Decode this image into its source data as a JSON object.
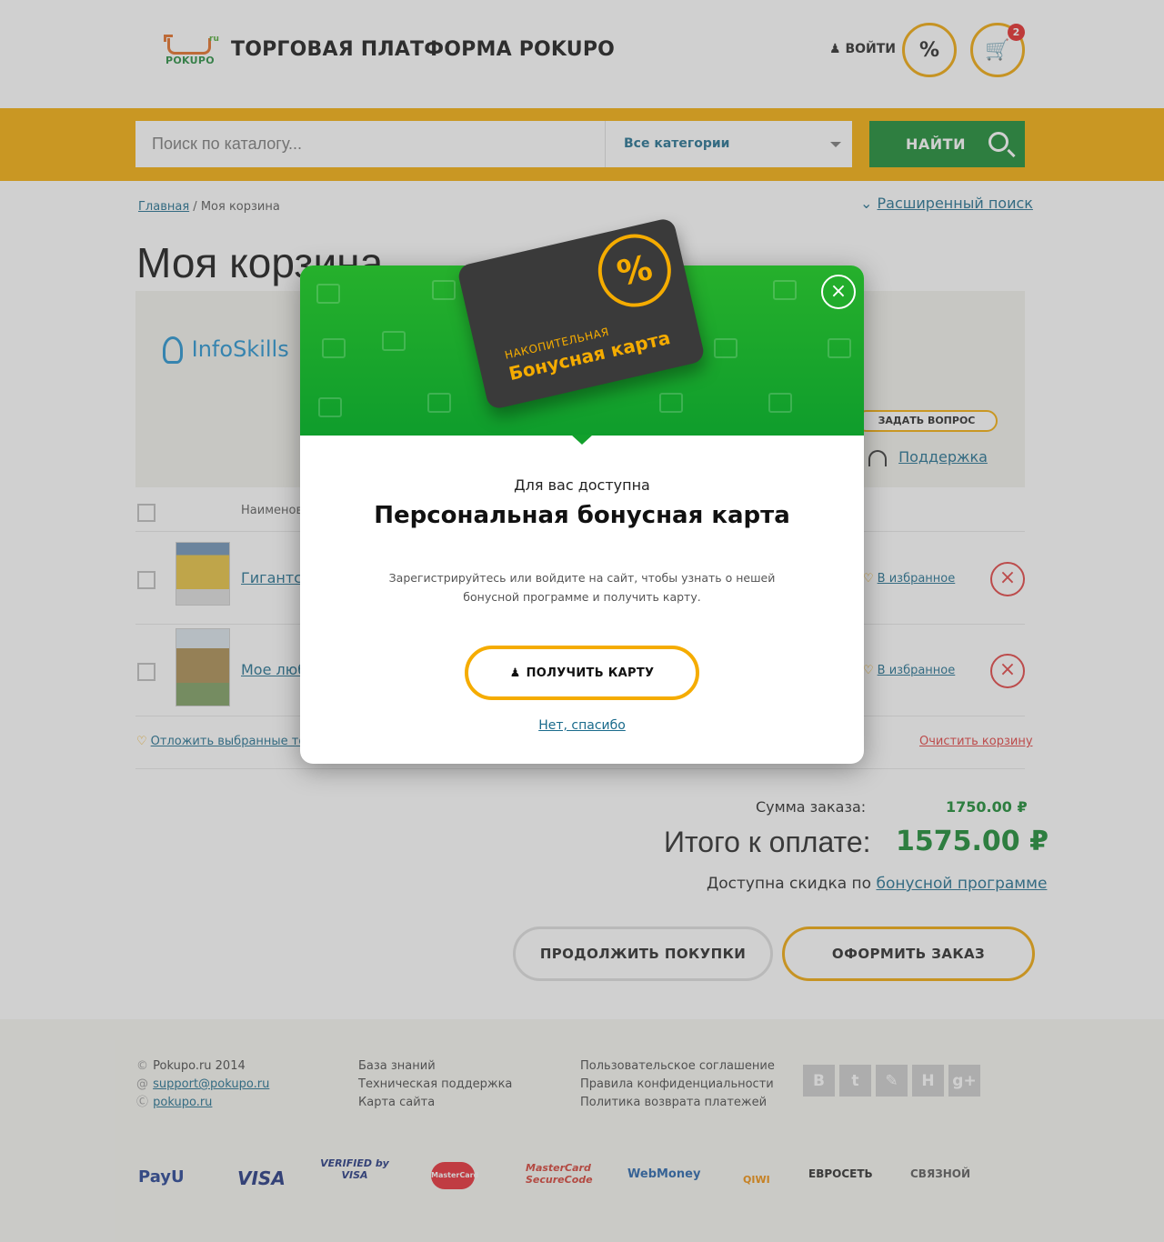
{
  "header": {
    "logo_brand": "POKUPO",
    "logo_ru": "ru",
    "title": "ТОРГОВАЯ ПЛАТФОРМА POKUPO",
    "login_label": "ВОЙТИ",
    "discount_icon": "%",
    "cart_count": "2"
  },
  "search": {
    "placeholder": "Поиск по каталогу...",
    "category": "Все категории",
    "button_label": "НАЙТИ"
  },
  "breadcrumb": {
    "home": "Главная",
    "separator": "/",
    "current": "Моя корзина"
  },
  "advanced_search": "Расширенный поиск",
  "page_title": "Моя корзина",
  "seller": {
    "name": "InfoSkills",
    "ask_button": "ЗАДАТЬ ВОПРОС",
    "support": "Поддержка"
  },
  "table": {
    "col_name": "Наименов"
  },
  "items": [
    {
      "name": "Гигантск",
      "fav": "В избранное"
    },
    {
      "name": "Мое люб",
      "fav": "В избранное"
    }
  ],
  "postpone": "Отложить выбранные то",
  "clear_cart": "Очистить корзину",
  "summary": {
    "sum_label": "Сумма заказа:",
    "sum_value": "1750.00 ₽",
    "total_label": "Итого к оплате:",
    "total_value": "1575.00 ₽",
    "bonus_prefix": "Доступна скидка по",
    "bonus_link": "бонусной программе"
  },
  "buttons": {
    "continue": "ПРОДОЛЖИТЬ ПОКУПКИ",
    "checkout": "ОФОРМИТЬ ЗАКАЗ"
  },
  "footer": {
    "copyright": "Pokupo.ru 2014",
    "email": "support@pokupo.ru",
    "skype": "pokupo.ru",
    "col2": [
      "База знаний",
      "Техническая поддержка",
      "Карта сайта"
    ],
    "col3": [
      "Пользовательское соглашение",
      "Правила конфиденциальности",
      "Политика возврата платежей"
    ],
    "social": [
      "B",
      "t",
      "✎",
      "H",
      "g+"
    ],
    "payments": [
      "PayU",
      "VISA",
      "VERIFIED by VISA",
      "MasterCard",
      "MasterCard SecureCode",
      "WebMoney",
      "QIWI",
      "ЕВРОСЕТЬ",
      "СВЯЗНОЙ"
    ]
  },
  "modal": {
    "card_line1": "НАКОПИТЕЛЬНАЯ",
    "card_line2": "Бонусная карта",
    "card_percent": "%",
    "pre_title": "Для вас доступна",
    "title": "Персональная бонусная карта",
    "text": "Зарегистрируйтесь или войдите на сайт, чтобы узнать о нешей бонусной программе и получить карту.",
    "cta": "ПОЛУЧИТЬ КАРТУ",
    "dismiss": "Нет, спасибо"
  },
  "colors": {
    "accent": "#f5ac00",
    "green": "#11872c",
    "link": "#1a6b8c",
    "danger": "#e23b3b"
  }
}
